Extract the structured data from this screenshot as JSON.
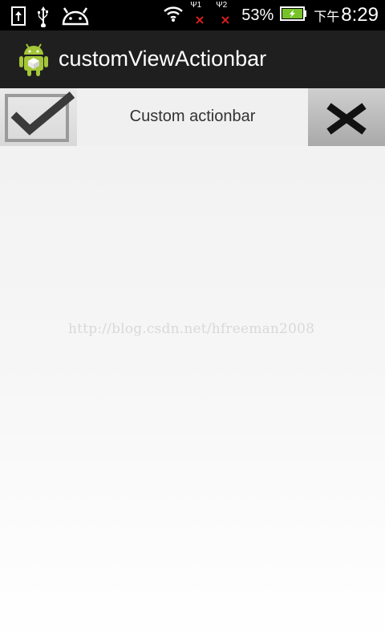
{
  "status_bar": {
    "battery_percent": "53%",
    "sim1_label": "1",
    "sim2_label": "2",
    "time_prefix": "下午",
    "time": "8:29",
    "icons": [
      "upload-icon",
      "usb-icon",
      "android-debug-icon",
      "wifi-icon",
      "signal-icon",
      "signal-icon",
      "battery-charging-icon"
    ]
  },
  "app_bar": {
    "title": "customViewActionbar",
    "icon": "android-app-icon"
  },
  "custom_bar": {
    "title": "Custom actionbar",
    "left_button_icon": "checkbox-checked-icon",
    "right_button_icon": "close-icon"
  },
  "watermark": "http://blog.csdn.net/hfreeman2008",
  "colors": {
    "status_bar": "#000000",
    "app_bar": "#1f1f1f",
    "background": "#f2f2f2",
    "battery_fill": "#77c22a",
    "signal_x": "#e02020"
  }
}
